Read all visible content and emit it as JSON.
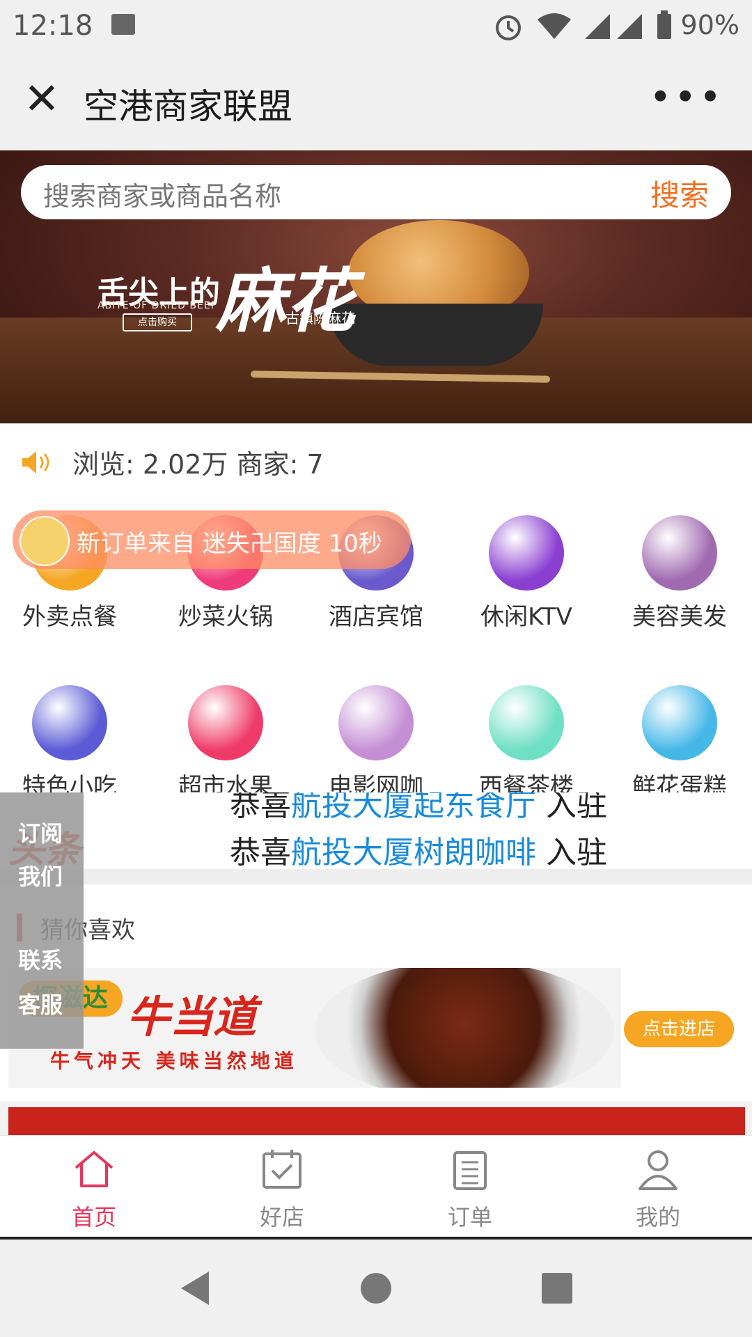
{
  "status_bar": {
    "time": "12:18",
    "battery": "90%",
    "icons": [
      "image-icon",
      "alarm-icon",
      "wifi-icon",
      "signal-icon",
      "signal-icon",
      "battery-icon"
    ]
  },
  "title_bar": {
    "title": "空港商家联盟",
    "close_icon": "close-icon",
    "more_icon": "more-icon"
  },
  "banner": {
    "headline_small": "舌尖上的",
    "headline_big": "麻花",
    "subtitle_en": "ABITE OF DRIED BEEF",
    "subtitle_cn": "古镇陈麻花",
    "cta": "点击购买"
  },
  "search": {
    "placeholder": "搜索商家或商品名称",
    "button": "搜索"
  },
  "stats": {
    "text": "浏览: 2.02万   商家: 7",
    "icon": "speaker-icon"
  },
  "toast": {
    "text": "新订单来自 迷失卍国度  10秒"
  },
  "categories": [
    {
      "label": "外卖点餐",
      "icon": "takeout-icon",
      "color": "#f6a623"
    },
    {
      "label": "炒菜火锅",
      "icon": "hotpot-icon",
      "color": "#ef3b7a"
    },
    {
      "label": "酒店宾馆",
      "icon": "hotel-icon",
      "color": "#6a5acd"
    },
    {
      "label": "休闲KTV",
      "icon": "microphone-icon",
      "color": "#8b3fd1"
    },
    {
      "label": "美容美发",
      "icon": "beauty-icon",
      "color": "#a06ab0"
    },
    {
      "label": "特色小吃",
      "icon": "pizza-icon",
      "color": "#5b5bd6"
    },
    {
      "label": "超市水果",
      "icon": "pineapple-icon",
      "color": "#ef3b68"
    },
    {
      "label": "电影网咖",
      "icon": "film-reel-icon",
      "color": "#c58fd6"
    },
    {
      "label": "西餐茶楼",
      "icon": "coffee-cup-icon",
      "color": "#6fe0c3"
    },
    {
      "label": "鲜花蛋糕",
      "icon": "cake-icon",
      "color": "#45b8e8"
    }
  ],
  "news": {
    "logo": "头条",
    "item1_prefix": "恭喜",
    "item1_link": "航投大厦起东食厅",
    "item1_suffix": "入驻",
    "item2_prefix": "恭喜",
    "item2_link": "航投大厦树朗咖啡",
    "item2_suffix": "入驻"
  },
  "side_float": {
    "line1": "订阅",
    "line2": "我们",
    "line3": "联系",
    "line4": "客服"
  },
  "guess": {
    "title": "猜你喜欢"
  },
  "shop_card": {
    "badge": "探滋达",
    "brand": "牛当道",
    "slogan": "牛气冲天 美味当然地道",
    "enter": "点击进店"
  },
  "bottom_nav": [
    {
      "label": "首页",
      "icon": "home-icon",
      "active": true
    },
    {
      "label": "好店",
      "icon": "calendar-check-icon",
      "active": false
    },
    {
      "label": "订单",
      "icon": "clipboard-icon",
      "active": false
    },
    {
      "label": "我的",
      "icon": "user-icon",
      "active": false
    }
  ],
  "system_nav": [
    "back-icon",
    "home-circle-icon",
    "recents-icon"
  ],
  "colors": {
    "accent_orange": "#f36f21",
    "active_pink": "#e8365a",
    "link_blue": "#1a8bdb"
  }
}
